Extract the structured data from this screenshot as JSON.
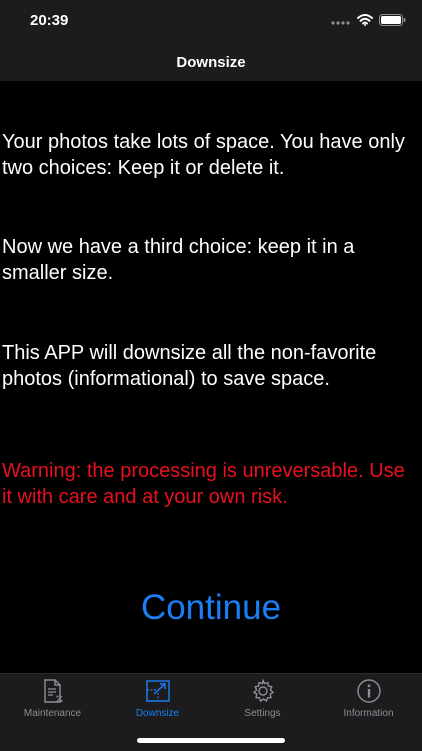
{
  "status_bar": {
    "time": "20:39",
    "signal_icon": "signal-dots-icon",
    "wifi_icon": "wifi-icon",
    "battery_icon": "battery-icon"
  },
  "nav": {
    "title": "Downsize"
  },
  "content": {
    "paragraph_1": "Your photos take lots of space.  You have only two choices:  Keep it or delete it.",
    "paragraph_2": "Now we have a third choice: keep it in a smaller size.",
    "paragraph_3": "This APP will downsize all the non-favorite photos (informational) to save space.",
    "warning": "Warning:  the processing is unreversable. Use it with care and at your own risk.",
    "continue_label": "Continue"
  },
  "tabs": [
    {
      "label": "Maintenance",
      "icon": "document-percent-icon",
      "active": false
    },
    {
      "label": "Downsize",
      "icon": "resize-icon",
      "active": true
    },
    {
      "label": "Settings",
      "icon": "gear-icon",
      "active": false
    },
    {
      "label": "Information",
      "icon": "info-icon",
      "active": false
    }
  ],
  "colors": {
    "accent": "#1a7ff5",
    "warning": "#e8101e",
    "background": "#000000",
    "bar_background": "#1c1c1e",
    "inactive_tab": "#8e8e93"
  }
}
